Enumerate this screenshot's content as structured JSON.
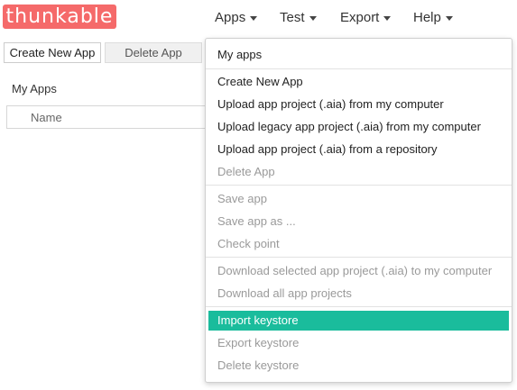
{
  "brand": {
    "logo_text": "thunkable",
    "logo_color": "#f56a6a"
  },
  "nav": {
    "items": [
      {
        "label": "Apps",
        "icon": "caret-down-icon"
      },
      {
        "label": "Test",
        "icon": "caret-down-icon"
      },
      {
        "label": "Export",
        "icon": "caret-down-icon"
      },
      {
        "label": "Help",
        "icon": "caret-down-icon"
      }
    ]
  },
  "toolbar": {
    "create_label": "Create New App",
    "delete_label": "Delete App"
  },
  "main": {
    "section_title": "My Apps",
    "table_header_name": "Name"
  },
  "apps_menu": {
    "header": "My apps",
    "items": [
      {
        "label": "Create New App",
        "enabled": true
      },
      {
        "label": "Upload app project (.aia) from my computer",
        "enabled": true
      },
      {
        "label": "Upload legacy app project (.aia) from my computer",
        "enabled": true
      },
      {
        "label": "Upload app project (.aia) from a repository",
        "enabled": true
      },
      {
        "label": "Delete App",
        "enabled": false
      },
      {
        "label": "Save app",
        "enabled": false
      },
      {
        "label": "Save app as ...",
        "enabled": false
      },
      {
        "label": "Check point",
        "enabled": false
      },
      {
        "label": "Download selected app project (.aia) to my computer",
        "enabled": false
      },
      {
        "label": "Download all app projects",
        "enabled": false
      },
      {
        "label": "Import keystore",
        "enabled": true,
        "highlighted": true
      },
      {
        "label": "Export keystore",
        "enabled": false
      },
      {
        "label": "Delete keystore",
        "enabled": false
      }
    ],
    "highlight_color": "#1abc9c"
  }
}
